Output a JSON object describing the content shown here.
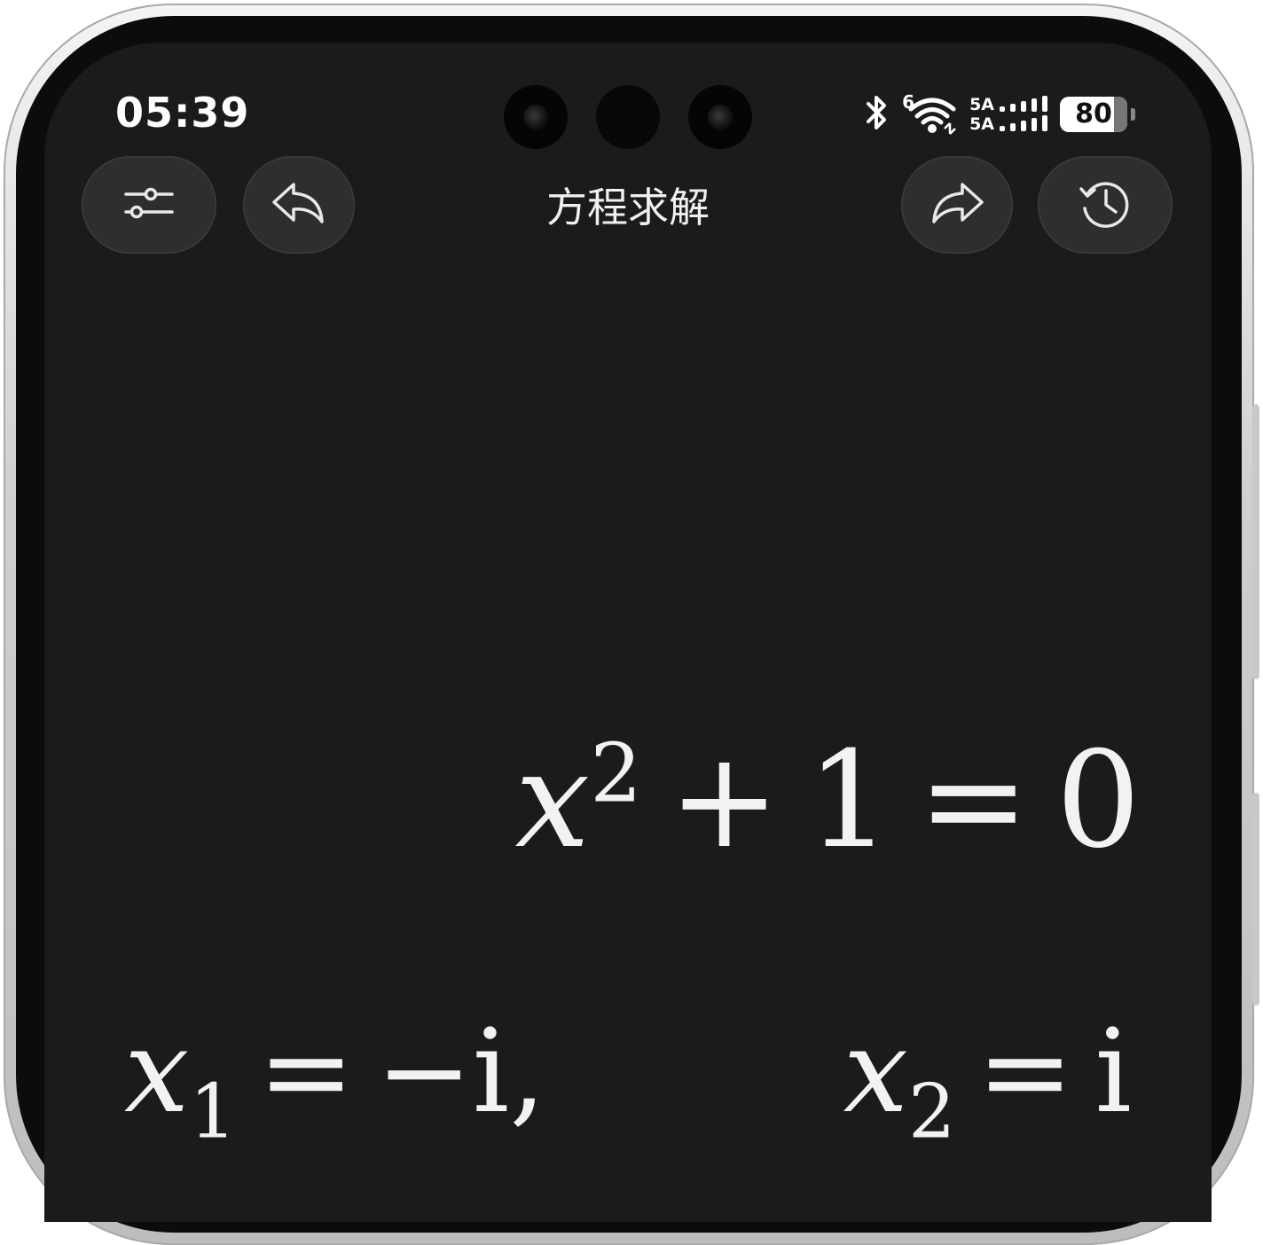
{
  "status_bar": {
    "time": "05:39",
    "wifi_badge": "6",
    "signal_line1": "5A",
    "signal_line2": "5A",
    "battery": "80",
    "battery_level": 0.8
  },
  "toolbar": {
    "title": "方程求解"
  },
  "equation": {
    "variable": "x",
    "exponent": "2",
    "plus": "+",
    "constant": "1",
    "equals": "=",
    "rhs": "0"
  },
  "solutions": [
    {
      "variable": "x",
      "subscript": "1",
      "equals": "=",
      "value": "−i,",
      "extra": ""
    },
    {
      "variable": "x",
      "subscript": "2",
      "equals": "=",
      "value": "i",
      "extra": ""
    }
  ],
  "colors": {
    "screen_bg": "#1b1b1b",
    "button_bg": "#2e2e2e",
    "text": "#f2f2f2"
  },
  "icons": [
    "sliders-icon",
    "undo-icon",
    "redo-icon",
    "history-icon",
    "bluetooth-icon",
    "wifi-icon",
    "cellular-signal-icon",
    "battery-icon"
  ]
}
